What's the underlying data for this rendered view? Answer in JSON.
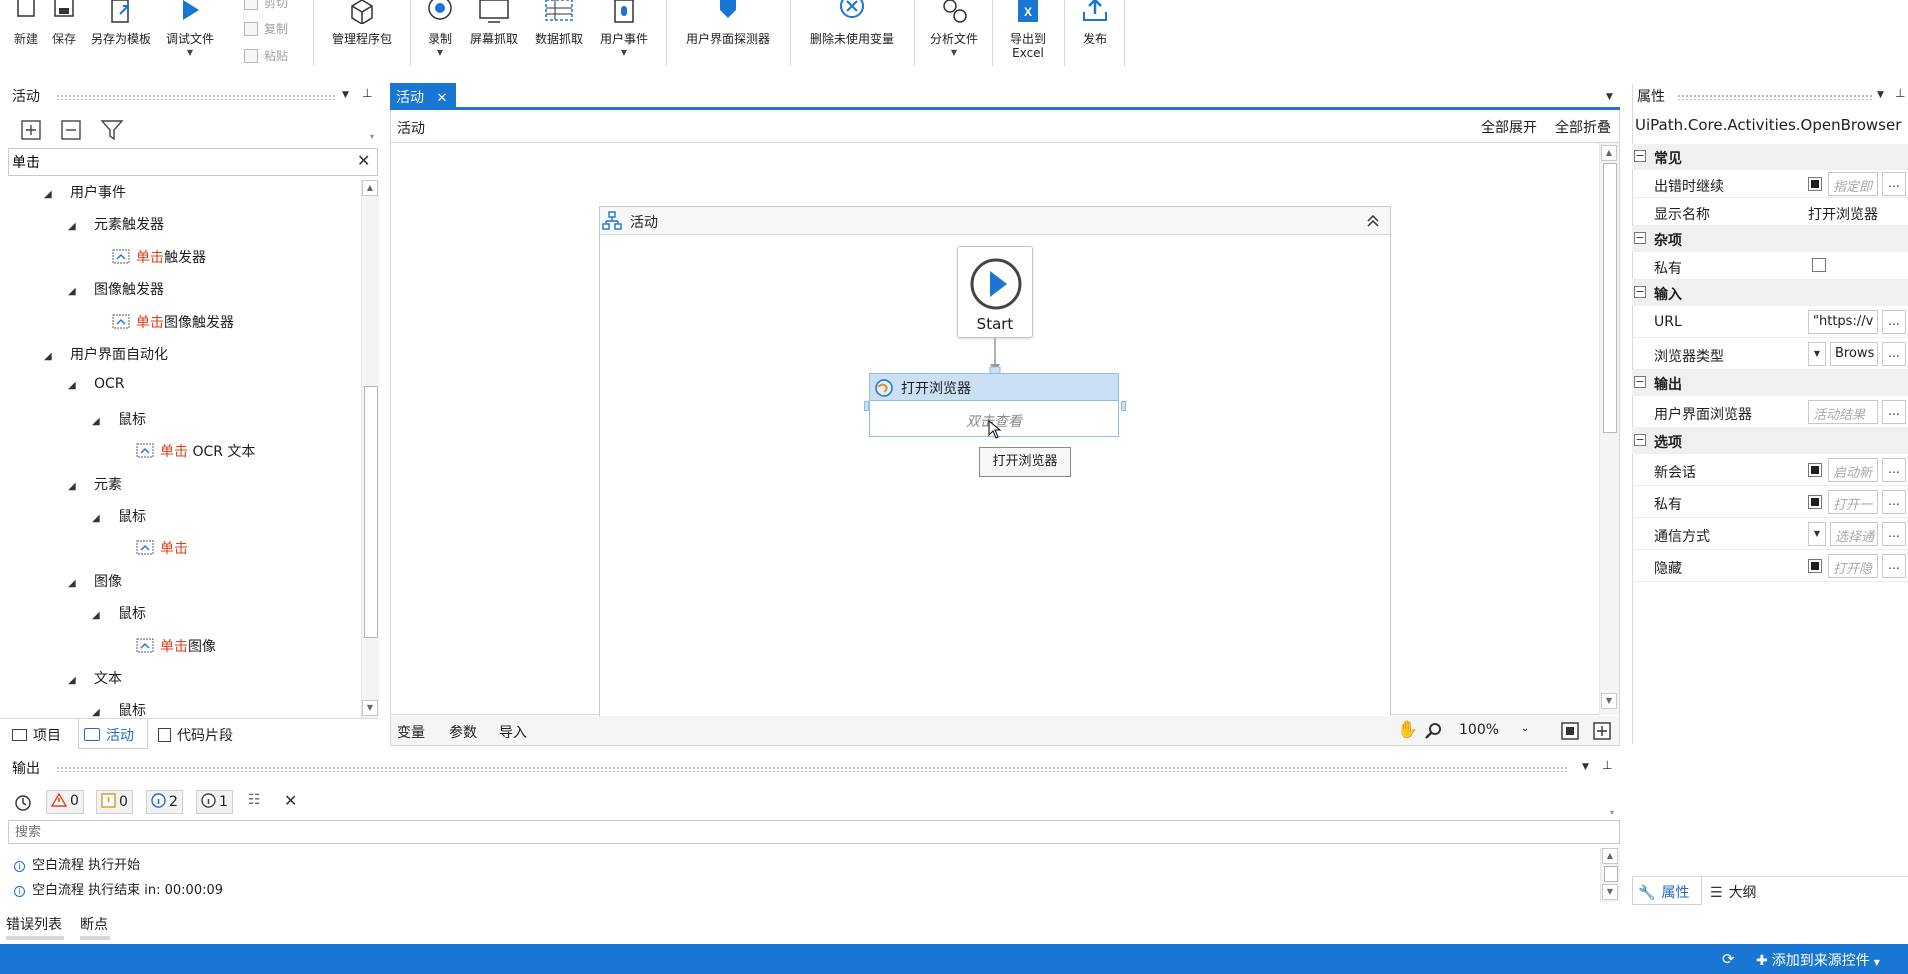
{
  "ribbon": {
    "new_label": "新建",
    "save_label": "保存",
    "save_template_label": "另存为模板",
    "debug_label": "调试文件",
    "cut_label": "剪切",
    "copy_label": "复制",
    "paste_label": "粘贴",
    "manage_packages_label": "管理程序包",
    "record_label": "录制",
    "screen_scraping_label": "屏幕抓取",
    "data_scraping_label": "数据抓取",
    "user_events_label": "用户事件",
    "ui_explorer_label": "用户界面探测器",
    "remove_unused_vars_label": "删除未使用变量",
    "analyze_file_label": "分析文件",
    "export_excel_label_line1": "导出到",
    "export_excel_label_line2": "Excel",
    "publish_label": "发布"
  },
  "activities_panel": {
    "title": "活动",
    "search_value": "单击",
    "highlight_term": "单击",
    "tree": [
      {
        "level": 1,
        "expanded": true,
        "label": "用户事件"
      },
      {
        "level": 2,
        "expanded": true,
        "label": "元素触发器"
      },
      {
        "level": 3,
        "leaf": true,
        "icon": "click-trigger-icon",
        "hl": "单击",
        "rest": "触发器"
      },
      {
        "level": 2,
        "expanded": true,
        "label": "图像触发器"
      },
      {
        "level": 3,
        "leaf": true,
        "icon": "image-trigger-icon",
        "hl": "单击",
        "rest": "图像触发器"
      },
      {
        "level": 1,
        "expanded": true,
        "label": "用户界面自动化"
      },
      {
        "level": 2,
        "expanded": true,
        "label": "OCR"
      },
      {
        "level": 3,
        "expanded": true,
        "label": "鼠标"
      },
      {
        "level": 4,
        "leaf": true,
        "icon": "ocr-text-icon",
        "hl": "单击",
        "rest": " OCR 文本"
      },
      {
        "level": 2,
        "expanded": true,
        "label": "元素"
      },
      {
        "level": 3,
        "expanded": true,
        "label": "鼠标"
      },
      {
        "level": 4,
        "leaf": true,
        "icon": "cursor-icon",
        "hl": "单击",
        "rest": ""
      },
      {
        "level": 2,
        "expanded": true,
        "label": "图像"
      },
      {
        "level": 3,
        "expanded": true,
        "label": "鼠标"
      },
      {
        "level": 4,
        "leaf": true,
        "icon": "click-image-icon",
        "hl": "单击",
        "rest": "图像"
      },
      {
        "level": 2,
        "expanded": true,
        "label": "文本"
      },
      {
        "level": 3,
        "expanded": true,
        "label": "鼠标"
      }
    ],
    "tabs": [
      "项目",
      "活动",
      "代码片段"
    ],
    "active_tab": "活动"
  },
  "designer": {
    "tab_label": "活动",
    "breadcrumb": "活动",
    "expand_all": "全部展开",
    "collapse_all": "全部折叠",
    "sequence_title": "活动",
    "start_label": "Start",
    "activity_title": "打开浏览器",
    "activity_hint": "双击查看",
    "tooltip": "打开浏览器",
    "bottom_tabs": [
      "变量",
      "参数",
      "导入"
    ],
    "zoom": "100%"
  },
  "properties": {
    "title": "属性",
    "class_name": "UiPath.Core.Activities.OpenBrowser",
    "groups": {
      "common": "常见",
      "misc": "杂项",
      "input": "输入",
      "output": "输出",
      "options": "选项"
    },
    "rows": {
      "continue_on_error": {
        "name": "出错时继续",
        "placeholder": "指定即"
      },
      "display_name": {
        "name": "显示名称",
        "value": "打开浏览器"
      },
      "private_misc": {
        "name": "私有"
      },
      "url": {
        "name": "URL",
        "value": "\"https://v"
      },
      "browser_type": {
        "name": "浏览器类型",
        "value": "Brows"
      },
      "ui_browser": {
        "name": "用户界面浏览器",
        "placeholder": "活动结果"
      },
      "new_session": {
        "name": "新会话",
        "placeholder": "启动新"
      },
      "private_opt": {
        "name": "私有",
        "placeholder": "打开一"
      },
      "communication": {
        "name": "通信方式",
        "placeholder": "选择通"
      },
      "hidden": {
        "name": "隐藏",
        "placeholder": "打开隐"
      }
    },
    "tabs": [
      "属性",
      "大纲"
    ],
    "active_tab": "属性"
  },
  "output_panel": {
    "title": "输出",
    "counts": {
      "error": "0",
      "warning": "0",
      "info": "2",
      "trace": "1"
    },
    "search_placeholder": "搜索",
    "lines": [
      "空白流程 执行开始",
      "空白流程 执行结束 in: 00:00:09"
    ]
  },
  "bottom_tabs": [
    "错误列表",
    "断点"
  ],
  "status_bar": {
    "source_control": "添加到来源控件"
  },
  "colors": {
    "accent": "#1976d2",
    "highlight": "#e0401a",
    "activity_header": "#cce0f5"
  }
}
